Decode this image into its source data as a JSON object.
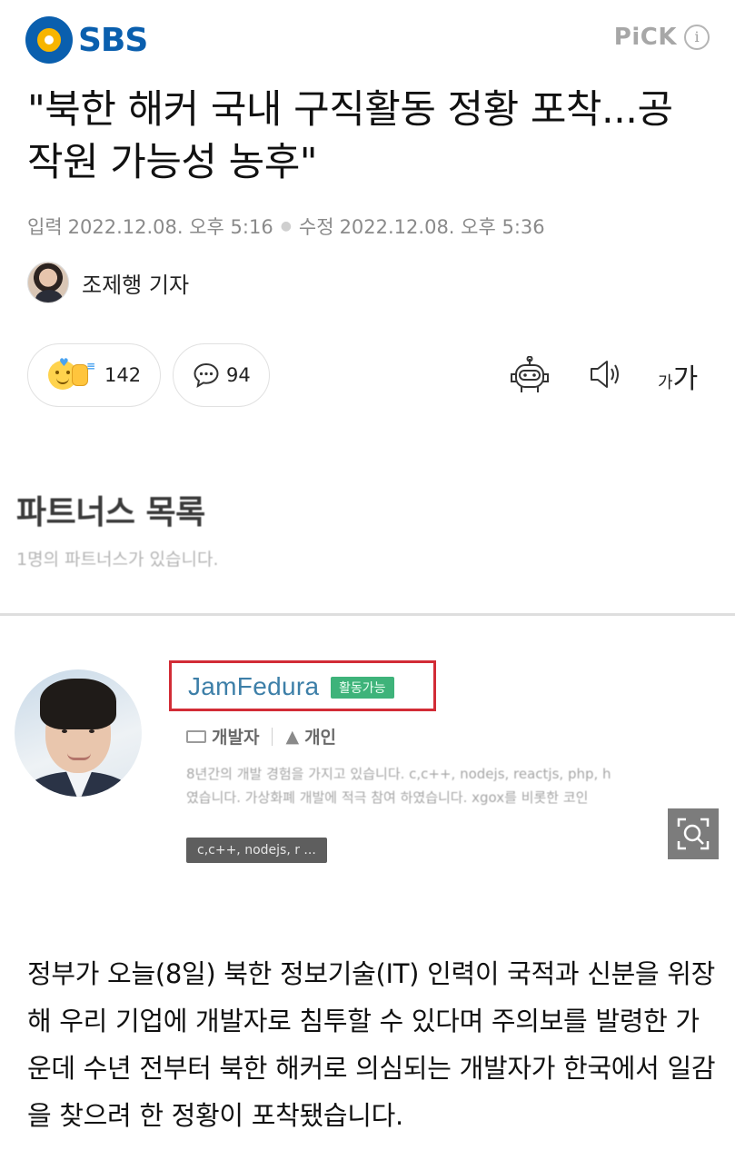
{
  "header": {
    "brand": "SBS",
    "pick_label": "PiCK",
    "info_glyph": "i"
  },
  "article": {
    "title": "\"북한 해커 국내 구직활동 정황 포착...공작원 가능성 농후\"",
    "input_label": "입력",
    "input_time": "2022.12.08. 오후 5:16",
    "modified_label": "수정",
    "modified_time": "2022.12.08. 오후 5:36",
    "author": "조제행 기자",
    "body": "정부가 오늘(8일) 북한 정보기술(IT) 인력이 국적과 신분을 위장해 우리 기업에 개발자로 침투할 수 있다며 주의보를 발령한 가운데 수년 전부터 북한 해커로 의심되는 개발자가 한국에서 일감을 찾으려 한 정황이 포착됐습니다."
  },
  "actions": {
    "reaction_count": "142",
    "comment_count": "94",
    "font_small": "가",
    "font_large": "가",
    "icons": [
      "reaction-icon",
      "comment-icon",
      "robot-icon",
      "speaker-icon",
      "font-size-icon"
    ]
  },
  "embedded": {
    "heading": "파트너스 목록",
    "subheading": "1명의 파트너스가 있습니다.",
    "partner": {
      "name": "JamFedura",
      "status": "활동가능",
      "role": "개발자",
      "type": "개인",
      "desc_line1": "8년간의 개발 경험을 가지고 있습니다. c,c++, nodejs, reactjs, php, h",
      "desc_line2": "였습니다. 가상화폐 개발에 적극 참여 하였습니다. xgox를 비롯한 코인",
      "skills": "c,c++, nodejs, r ..."
    }
  },
  "colors": {
    "brand_blue": "#0a5fae",
    "brand_yellow": "#f7b500",
    "highlight_red": "#d22c36",
    "status_green": "#3eb37a"
  }
}
